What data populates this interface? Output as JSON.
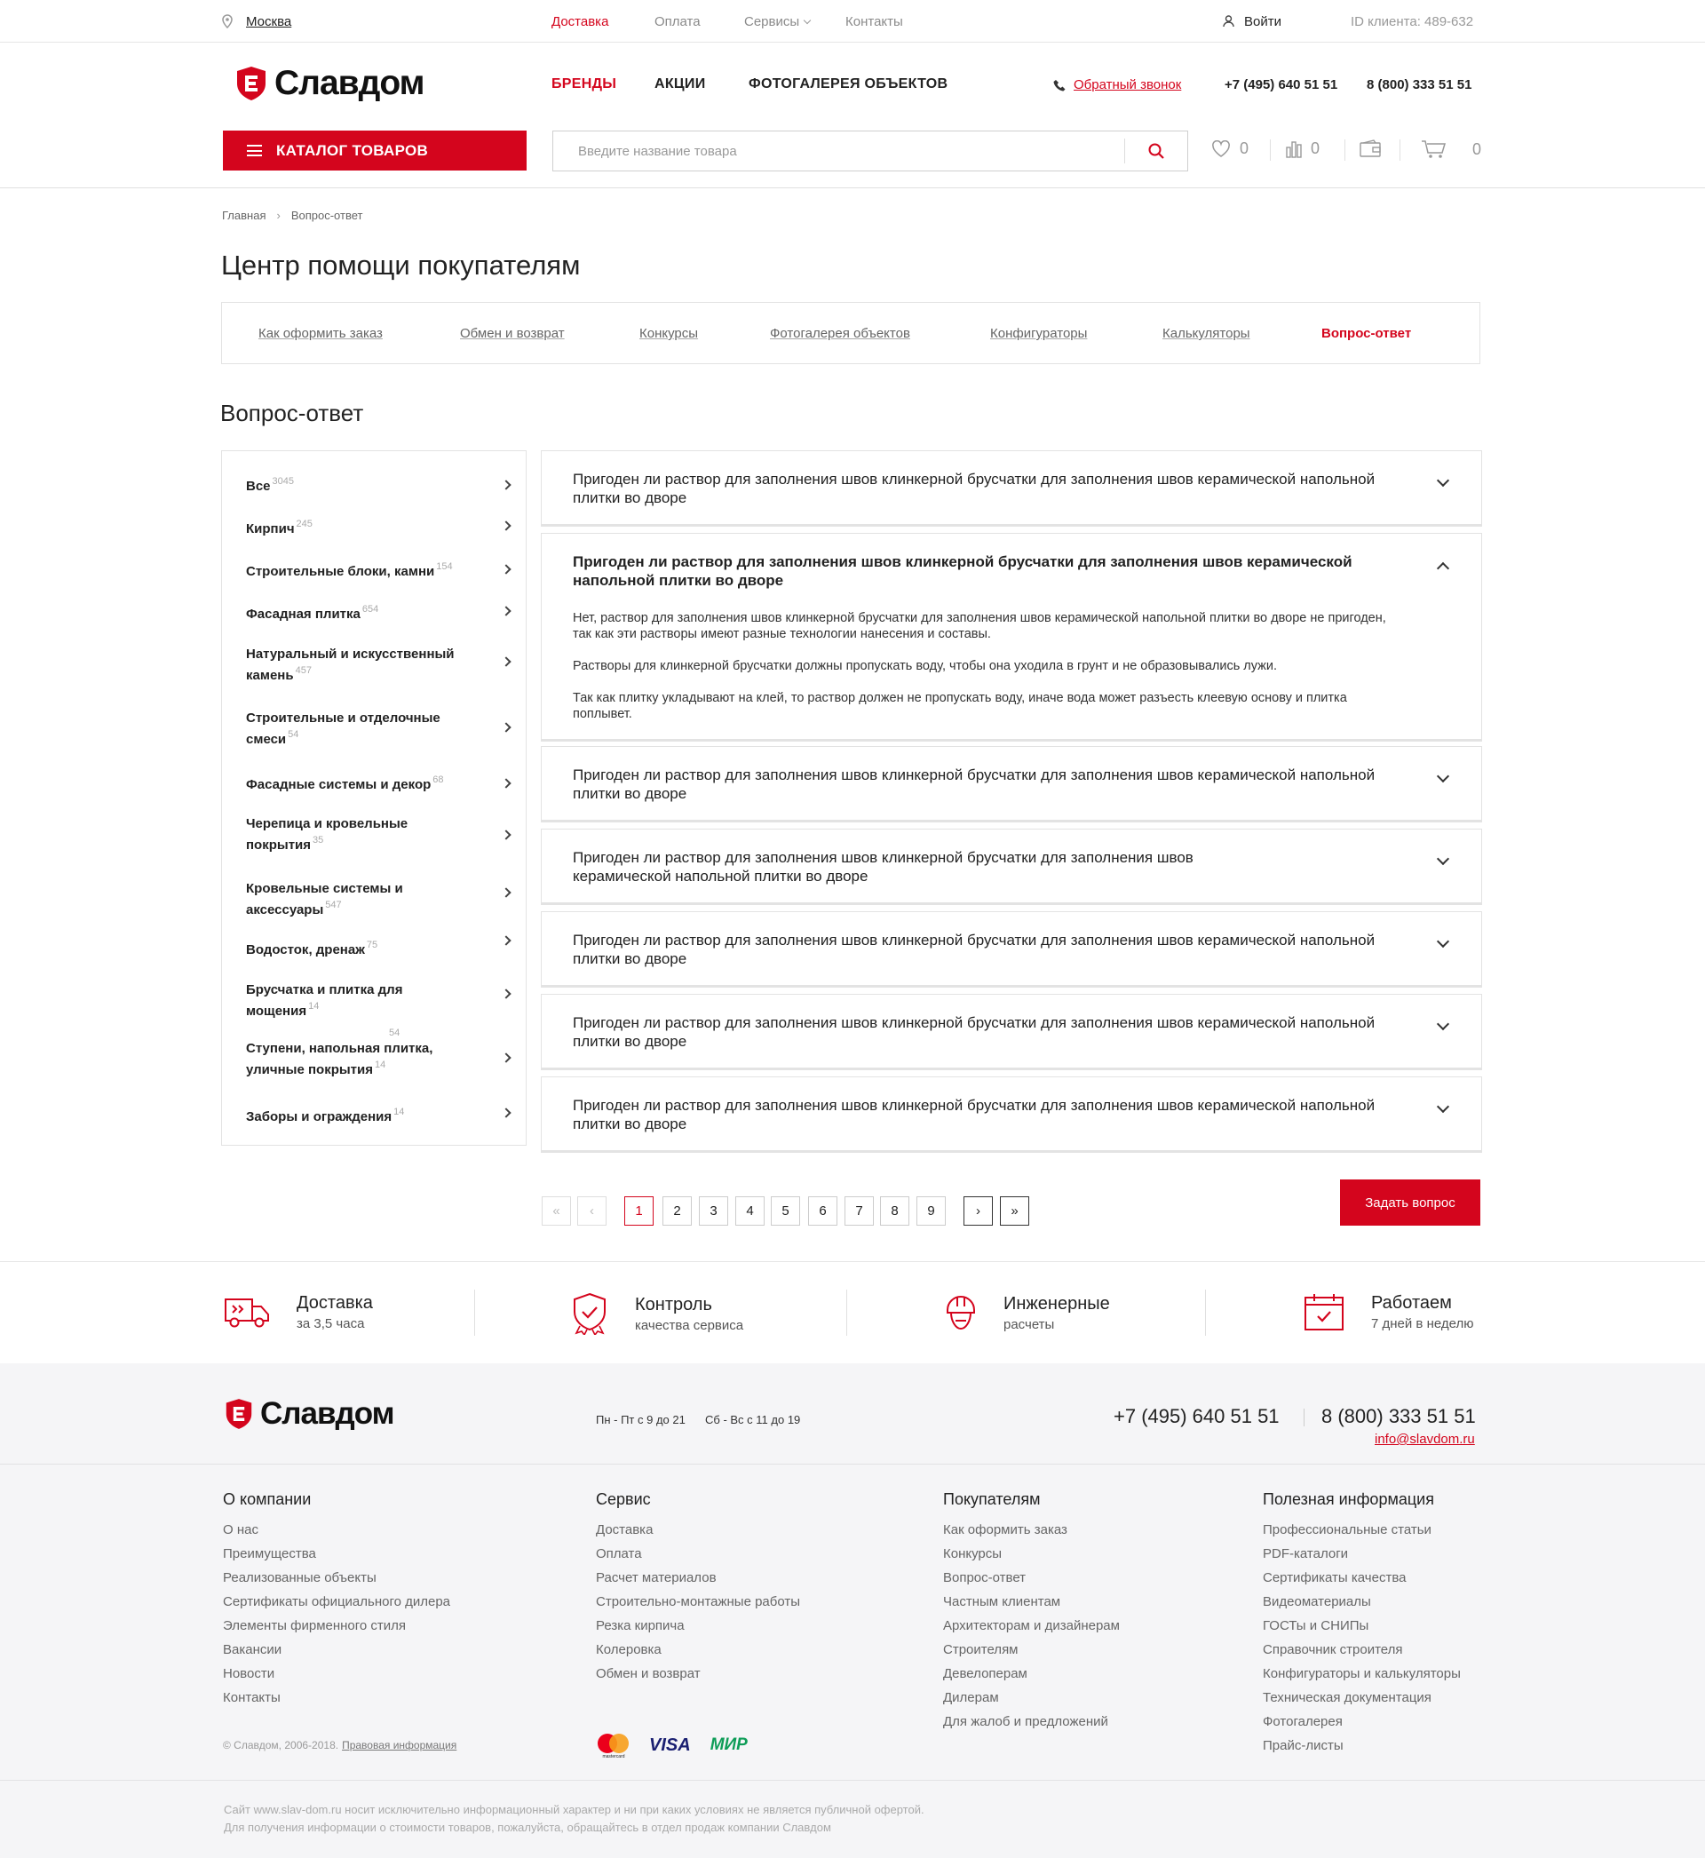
{
  "topbar": {
    "city": "Москва",
    "links": [
      "Доставка",
      "Оплата",
      "Сервисы",
      "Контакты"
    ],
    "login": "Войти",
    "client_id": "ID клиента: 489-632"
  },
  "brand": {
    "name": "Славдом",
    "accent": "#d4051d"
  },
  "header": {
    "nav": [
      "БРЕНДЫ",
      "АКЦИИ",
      "ФОТОГАЛЕРЕЯ ОБЪЕКТОВ"
    ],
    "callback": "Обратный звонок",
    "phone1": "+7 (495) 640 51 51",
    "phone2": "8 (800) 333 51 51",
    "catalog": "КАТАЛОГ ТОВАРОВ",
    "search_placeholder": "Введите название товара",
    "favorites_count": "0",
    "compare_count": "0",
    "cart_count": "0"
  },
  "breadcrumbs": [
    "Главная",
    "Вопрос-ответ"
  ],
  "page_title": "Центр помощи покупателям",
  "help_tabs": [
    "Как оформить заказ",
    "Обмен и возврат",
    "Конкурсы",
    "Фотогалерея объектов",
    "Конфигураторы",
    "Калькуляторы",
    "Вопрос-ответ"
  ],
  "section_title": "Вопрос-ответ",
  "categories": [
    {
      "label": "Все",
      "count": "3045"
    },
    {
      "label": "Кирпич",
      "count": "245"
    },
    {
      "label": "Строительные блоки, камни",
      "count": "154"
    },
    {
      "label": "Фасадная плитка",
      "count": "654"
    },
    {
      "label": "Натуральный и искусственный камень",
      "count": "457"
    },
    {
      "label": "Строительные и отделочные смеси",
      "count": "54"
    },
    {
      "label": "Фасадные системы и декор",
      "count": "68"
    },
    {
      "label": "Черепица и кровельные покрытия",
      "count": "35"
    },
    {
      "label": "Кровельные системы и аксессуары",
      "count": "547"
    },
    {
      "label": "Водосток, дренаж",
      "count": "75"
    },
    {
      "label": "Брусчатка и плитка для мощения",
      "count": "14"
    },
    {
      "label": "Ступени, напольная плитка, уличные покрытия",
      "count": "14",
      "count_top": "54"
    },
    {
      "label": "Заборы и ограждения",
      "count": "14"
    }
  ],
  "faq": {
    "question": "Пригоден ли раствор для заполнения швов клинкерной брусчатки для заполнения швов керамической напольной плитки во дворе",
    "answer": [
      "Нет, раствор для заполнения швов клинкерной брусчатки для заполнения швов керамической напольной плитки во дворе не пригоден, так как эти растворы имеют разные технологии нанесения и составы.",
      "Растворы для клинкерной брусчатки должны пропускать воду, чтобы она уходила в грунт и не образовывались лужи.",
      "Так как плитку укладывают на клей, то раствор должен не пропускать воду, иначе вода может разъесть клеевую основу и плитка поплывет."
    ],
    "expanded_index": 1
  },
  "pagination": {
    "first": "«",
    "prev": "‹",
    "pages": [
      "1",
      "2",
      "3",
      "4",
      "5",
      "6",
      "7",
      "8",
      "9"
    ],
    "current": "1",
    "next": "›",
    "last": "»"
  },
  "ask_button": "Задать вопрос",
  "features": [
    {
      "title": "Доставка",
      "sub": "за 3,5 часа"
    },
    {
      "title": "Контроль",
      "sub": "качества сервиса"
    },
    {
      "title": "Инженерные",
      "sub": "расчеты"
    },
    {
      "title": "Работаем",
      "sub": "7 дней в неделю"
    }
  ],
  "footer": {
    "hours1": "Пн - Пт с 9 до 21",
    "hours2": "Сб - Вс с 11 до 19",
    "phone1": "+7 (495) 640 51 51",
    "phone2": "8 (800) 333 51 51",
    "email": "info@slavdom.ru",
    "columns": [
      {
        "title": "О компании",
        "links": [
          "О нас",
          "Преимущества",
          "Реализованные объекты",
          "Сертификаты официального дилера",
          "Элементы фирменного стиля",
          "Вакансии",
          "Новости",
          "Контакты"
        ]
      },
      {
        "title": "Сервис",
        "links": [
          "Доставка",
          "Оплата",
          "Расчет материалов",
          "Строительно-монтажные работы",
          "Резка кирпича",
          "Колеровка",
          "Обмен и возврат"
        ]
      },
      {
        "title": "Покупателям",
        "links": [
          "Как оформить заказ",
          "Конкурсы",
          "Вопрос-ответ",
          "Частным клиентам",
          "Архитекторам и дизайнерам",
          "Строителям",
          "Девелоперам",
          "Дилерам",
          "Для жалоб и предложений"
        ]
      },
      {
        "title": "Полезная информация",
        "links": [
          "Профессиональные статьи",
          "PDF-каталоги",
          "Сертификаты качества",
          "Видеоматериалы",
          "ГОСТы и СНИПы",
          "Справочник строителя",
          "Конфигураторы и калькуляторы",
          "Техническая документация",
          "Фотогалерея",
          "Прайс-листы"
        ]
      }
    ],
    "copyright": "© Славдом, 2006-2018.",
    "legal": "Правовая информация",
    "payments": [
      "mastercard",
      "VISA",
      "МИР"
    ],
    "disclaimer1": "Сайт www.slav-dom.ru носит исключительно информационный характер и ни при каких условиях не является публичной офертой.",
    "disclaimer2": "Для получения информации о стоимости товаров, пожалуйста, обращайтесь в отдел продаж компании Славдом"
  }
}
